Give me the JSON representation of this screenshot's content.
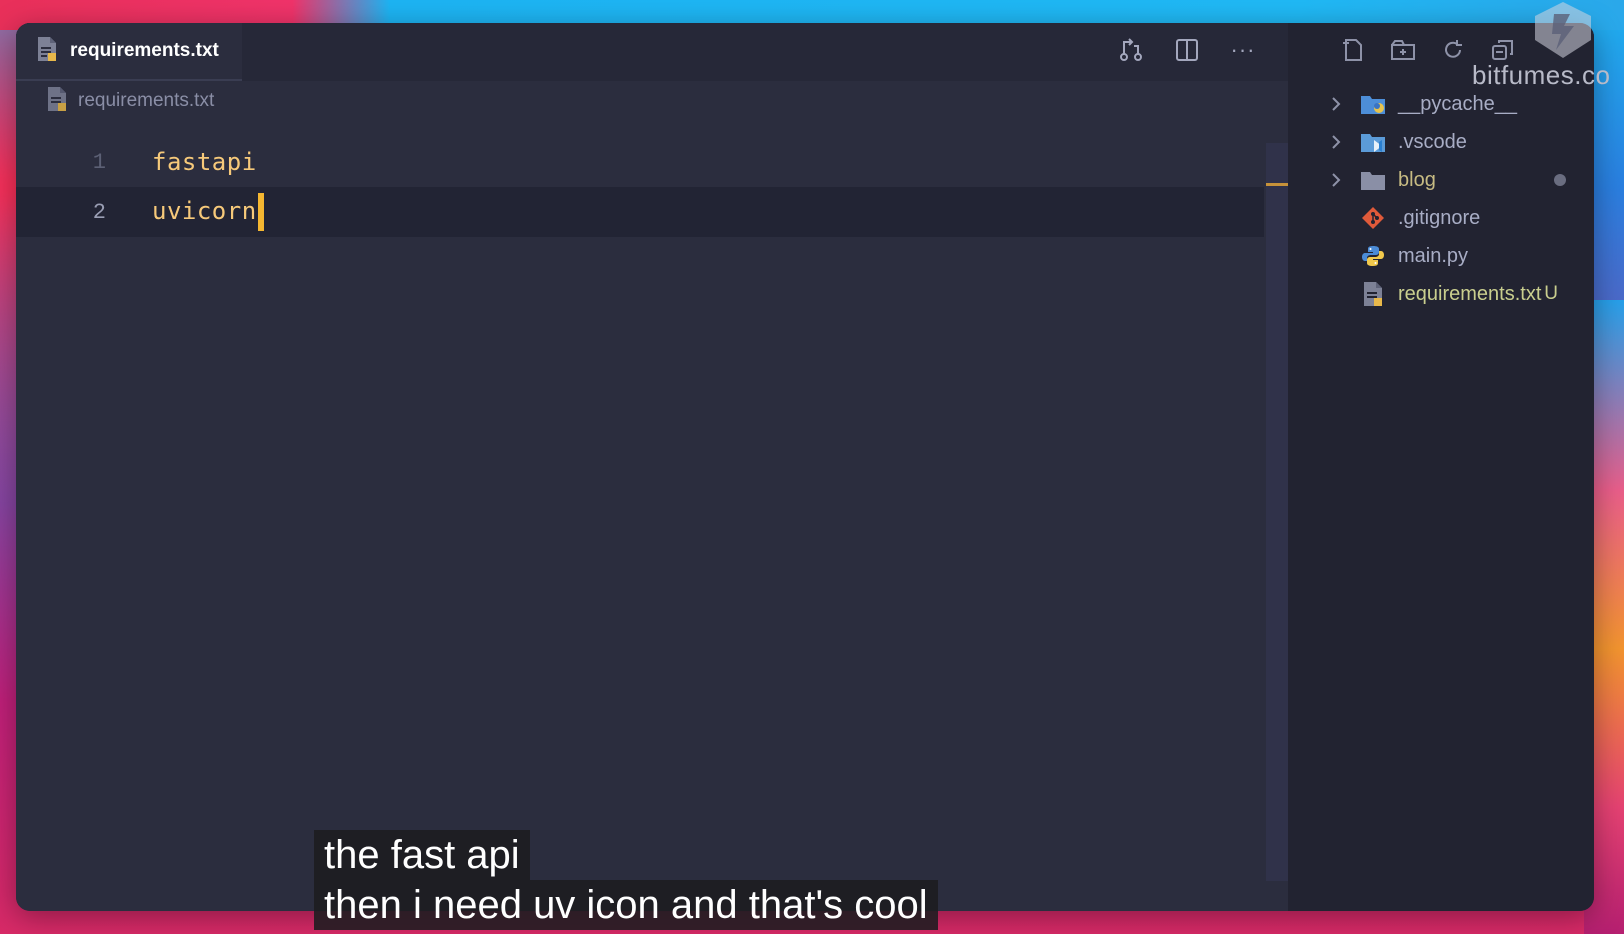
{
  "editor": {
    "tab_label": "requirements.txt",
    "breadcrumb_label": "requirements.txt",
    "actions": [
      "open-changes-icon",
      "split-editor-icon",
      "more-actions-icon"
    ],
    "more_label": "···",
    "lines": [
      {
        "number": "1",
        "text": "fastapi"
      },
      {
        "number": "2",
        "text": "uvicorn"
      }
    ]
  },
  "explorer": {
    "actions": [
      "new-file-icon",
      "new-folder-icon",
      "refresh-icon",
      "collapse-all-icon"
    ],
    "items": [
      {
        "label": "__pycache__",
        "icon": "python-folder-icon",
        "type": "folder"
      },
      {
        "label": ".vscode",
        "icon": "vscode-folder-icon",
        "type": "folder"
      },
      {
        "label": "blog",
        "icon": "folder-icon",
        "type": "folder"
      },
      {
        "label": ".gitignore",
        "icon": "git-icon",
        "type": "file"
      },
      {
        "label": "main.py",
        "icon": "python-icon",
        "type": "file"
      },
      {
        "label": "requirements.txt",
        "icon": "text-file-icon",
        "type": "file",
        "badge": "U"
      }
    ]
  },
  "watermark": "bitfumes.co",
  "captions": {
    "line1": "the fast api",
    "line2": "then i need uv icon and that's cool"
  },
  "colors": {
    "editor_bg": "#2b2d3e",
    "sidebar_bg": "#222331",
    "code_text": "#f6c97a",
    "cursor": "#f5b731",
    "untracked": "#c9ce8e"
  }
}
